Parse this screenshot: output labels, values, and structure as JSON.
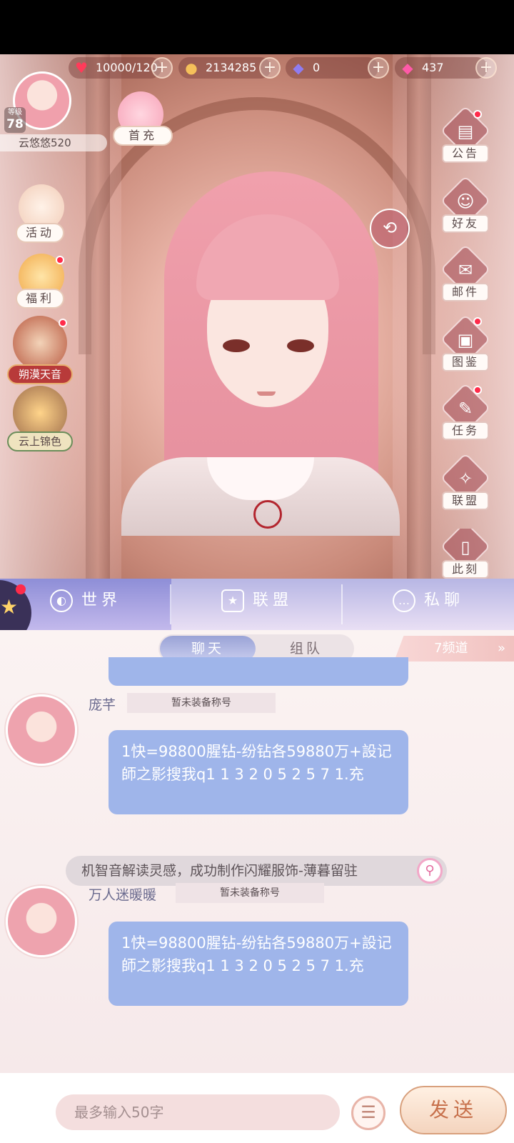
{
  "resources": {
    "stamina": "10000/120",
    "gold": "2134285",
    "diamonds": "0",
    "gems": "437"
  },
  "player": {
    "level_label": "等级",
    "level": "78",
    "name": "云悠悠520"
  },
  "left_menu": {
    "first_charge": "首充",
    "activity": "活动",
    "welfare": "福利",
    "event1": "朔漠天音",
    "event2": "云上锦色"
  },
  "right_menu": [
    {
      "label": "公告",
      "glyph": "▤"
    },
    {
      "label": "好友",
      "glyph": "☺"
    },
    {
      "label": "邮件",
      "glyph": "✉"
    },
    {
      "label": "图鉴",
      "glyph": "▣"
    },
    {
      "label": "任务",
      "glyph": "✎"
    },
    {
      "label": "联盟",
      "glyph": "✧"
    },
    {
      "label": "此刻",
      "glyph": "▯"
    }
  ],
  "chat": {
    "tabs": [
      "世界",
      "联盟",
      "私聊"
    ],
    "subtabs": [
      "聊天",
      "组队"
    ],
    "channel": "7频道",
    "messages": [
      {
        "user": "庞芊",
        "title": "暂未装备称号",
        "text": "1快=98800腥钻-纷钻各59880万+設记師之影搜我q1 1 3 2 0 5 2 5 7 1.充"
      },
      {
        "system": "机智音解读灵感，成功制作闪耀服饰-薄暮留驻"
      },
      {
        "user": "万人迷暖暖",
        "title": "暂未装备称号",
        "text": "1快=98800腥钻-纷钻各59880万+設记師之影搜我q1 1 3 2 0 5 2 5 7 1.充"
      }
    ],
    "input_placeholder": "最多输入50字",
    "send_label": "发送"
  }
}
